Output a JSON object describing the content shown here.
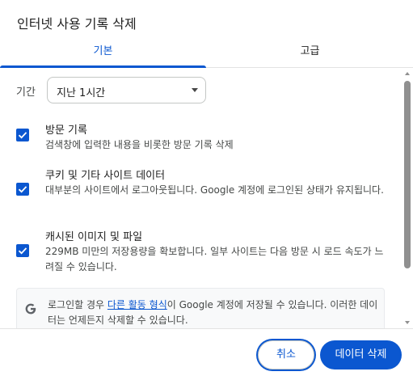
{
  "dialog": {
    "title": "인터넷 사용 기록 삭제"
  },
  "tabs": [
    {
      "label": "기본",
      "selected": true
    },
    {
      "label": "고급",
      "selected": false
    }
  ],
  "time_range": {
    "label": "기간",
    "value": "지난 1시간"
  },
  "options": [
    {
      "title": "방문 기록",
      "description": "검색창에 입력한 내용을 비롯한 방문 기록 삭제",
      "checked": true
    },
    {
      "title": "쿠키 및 기타 사이트 데이터",
      "description": "대부분의 사이트에서 로그아웃됩니다. Google 계정에 로그인된 상태가 유지됩니다.",
      "checked": true
    },
    {
      "title": "캐시된 이미지 및 파일",
      "description": "229MB 미만의 저장용량을 확보합니다. 일부 사이트는 다음 방문 시 로드 속도가 느려질 수 있습니다.",
      "checked": true
    }
  ],
  "info": {
    "text_before": "로그인할 경우 ",
    "link": "다른 활동 형식",
    "text_after": "이 Google 계정에 저장될 수 있습니다. 이러한 데이터는 언제든지 삭제할 수 있습니다."
  },
  "footer": {
    "cancel_label": "취소",
    "delete_label": "데이터 삭제"
  },
  "colors": {
    "accent": "#0b57d0",
    "text": "#1f1f1f",
    "secondary_text": "#444746"
  }
}
